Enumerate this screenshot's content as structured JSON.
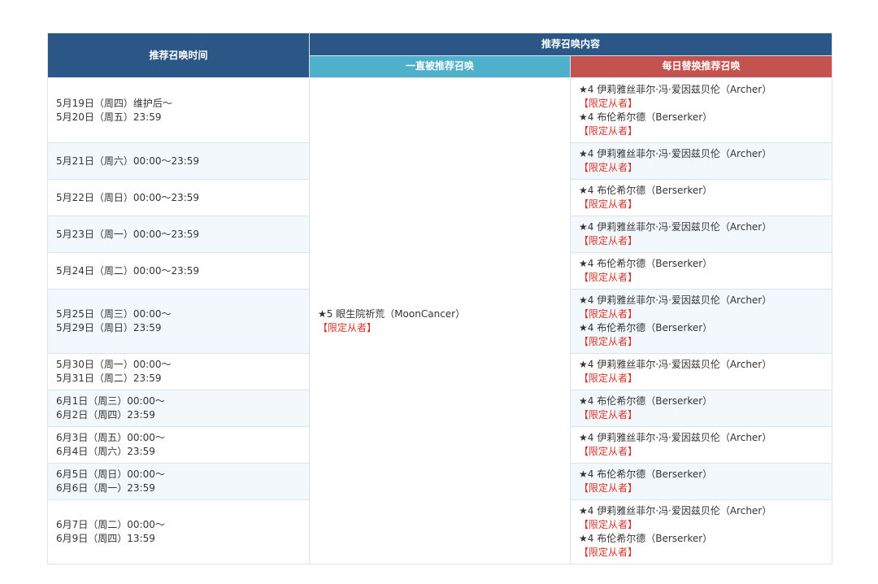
{
  "header": {
    "time": "推荐召唤时间",
    "content": "推荐召唤内容",
    "fixed": "一直被推荐召唤",
    "daily": "每日替换推荐召唤"
  },
  "fixed": {
    "name": "★5 眼生院祈荒（MoonCancer）",
    "tag": "【限定从者】"
  },
  "rows": [
    {
      "time": [
        "5月19日（周四）维护后～",
        "5月20日（周五）23:59"
      ],
      "servants": [
        {
          "name": "★4 伊莉雅丝菲尔·冯·爱因兹贝伦（Archer）",
          "tag": "【限定从者】"
        },
        {
          "name": "★4 布伦希尔德（Berserker）",
          "tag": "【限定从者】"
        }
      ]
    },
    {
      "time": [
        "5月21日（周六）00:00～23:59"
      ],
      "servants": [
        {
          "name": "★4 伊莉雅丝菲尔·冯·爱因兹贝伦（Archer）",
          "tag": "【限定从者】"
        }
      ]
    },
    {
      "time": [
        "5月22日（周日）00:00～23:59"
      ],
      "servants": [
        {
          "name": "★4 布伦希尔德（Berserker）",
          "tag": "【限定从者】"
        }
      ]
    },
    {
      "time": [
        "5月23日（周一）00:00～23:59"
      ],
      "servants": [
        {
          "name": "★4 伊莉雅丝菲尔·冯·爱因兹贝伦（Archer）",
          "tag": "【限定从者】"
        }
      ]
    },
    {
      "time": [
        "5月24日（周二）00:00～23:59"
      ],
      "servants": [
        {
          "name": "★4 布伦希尔德（Berserker）",
          "tag": "【限定从者】"
        }
      ]
    },
    {
      "time": [
        "5月25日（周三）00:00～",
        "5月29日（周日）23:59"
      ],
      "servants": [
        {
          "name": "★4 伊莉雅丝菲尔·冯·爱因兹贝伦（Archer）",
          "tag": "【限定从者】"
        },
        {
          "name": "★4 布伦希尔德（Berserker）",
          "tag": "【限定从者】"
        }
      ]
    },
    {
      "time": [
        "5月30日（周一）00:00～",
        "5月31日（周二）23:59"
      ],
      "servants": [
        {
          "name": "★4 伊莉雅丝菲尔·冯·爱因兹贝伦（Archer）",
          "tag": "【限定从者】"
        }
      ]
    },
    {
      "time": [
        "6月1日（周三）00:00～",
        "6月2日（周四）23:59"
      ],
      "servants": [
        {
          "name": "★4 布伦希尔德（Berserker）",
          "tag": "【限定从者】"
        }
      ]
    },
    {
      "time": [
        "6月3日（周五）00:00～",
        "6月4日（周六）23:59"
      ],
      "servants": [
        {
          "name": "★4 伊莉雅丝菲尔·冯·爱因兹贝伦（Archer）",
          "tag": "【限定从者】"
        }
      ]
    },
    {
      "time": [
        "6月5日（周日）00:00～",
        "6月6日（周一）23:59"
      ],
      "servants": [
        {
          "name": "★4 布伦希尔德（Berserker）",
          "tag": "【限定从者】"
        }
      ]
    },
    {
      "time": [
        "6月7日（周二）00:00～",
        "6月9日（周四）13:59"
      ],
      "servants": [
        {
          "name": "★4 伊莉雅丝菲尔·冯·爱因兹贝伦（Archer）",
          "tag": "【限定从者】"
        },
        {
          "name": "★4 布伦希尔德（Berserker）",
          "tag": "【限定从者】"
        }
      ]
    }
  ]
}
